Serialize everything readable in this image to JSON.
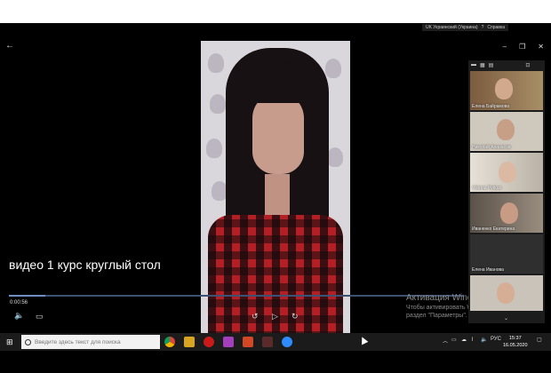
{
  "ime_bar": {
    "language": "UK Украинский (Украина)",
    "help": "Справка"
  },
  "window_controls": {
    "minimize": "–",
    "restore": "❐",
    "close": "✕"
  },
  "video": {
    "caption": "видео 1 курс круглый стол",
    "elapsed": "0:00:56",
    "progress": 0.08
  },
  "controls": {
    "back": "←",
    "volume": "🔈",
    "subtitles": "▭",
    "rewind": "↺",
    "play": "▷",
    "forward": "↻"
  },
  "activation": {
    "title": "Активация Wind",
    "line1": "Чтобы активировать W",
    "line2": "раздел \"Параметры\"."
  },
  "participants": [
    {
      "name": "Елена Байрамова"
    },
    {
      "name": "Николай Апанасов"
    },
    {
      "name": "Viktoria Pytkun"
    },
    {
      "name": "Иваненко Екатерина"
    },
    {
      "name": "Елена Иванова"
    },
    {
      "name": ""
    }
  ],
  "taskbar": {
    "search_placeholder": "Введите здесь текст для поиска",
    "language": "РУС",
    "time": "15:37",
    "date": "16.05.2020"
  }
}
